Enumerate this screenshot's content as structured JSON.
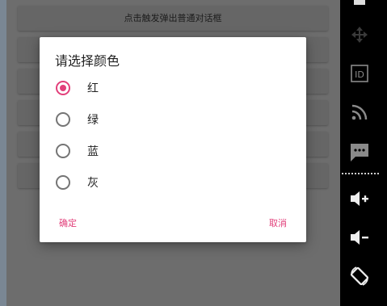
{
  "app": {
    "button_label": "点击触发弹出普通对话框"
  },
  "dialog": {
    "title": "请选择颜色",
    "options": [
      {
        "label": "红",
        "checked": true
      },
      {
        "label": "绿",
        "checked": false
      },
      {
        "label": "蓝",
        "checked": false
      },
      {
        "label": "灰",
        "checked": false
      }
    ],
    "confirm_label": "确定",
    "cancel_label": "取消"
  },
  "colors": {
    "accent": "#e2407b"
  },
  "sidebar": {
    "icons": [
      "power-icon",
      "move-icon",
      "id-icon",
      "rss-icon",
      "chat-icon",
      "volume-up-icon",
      "volume-down-icon",
      "rotate-icon"
    ]
  }
}
